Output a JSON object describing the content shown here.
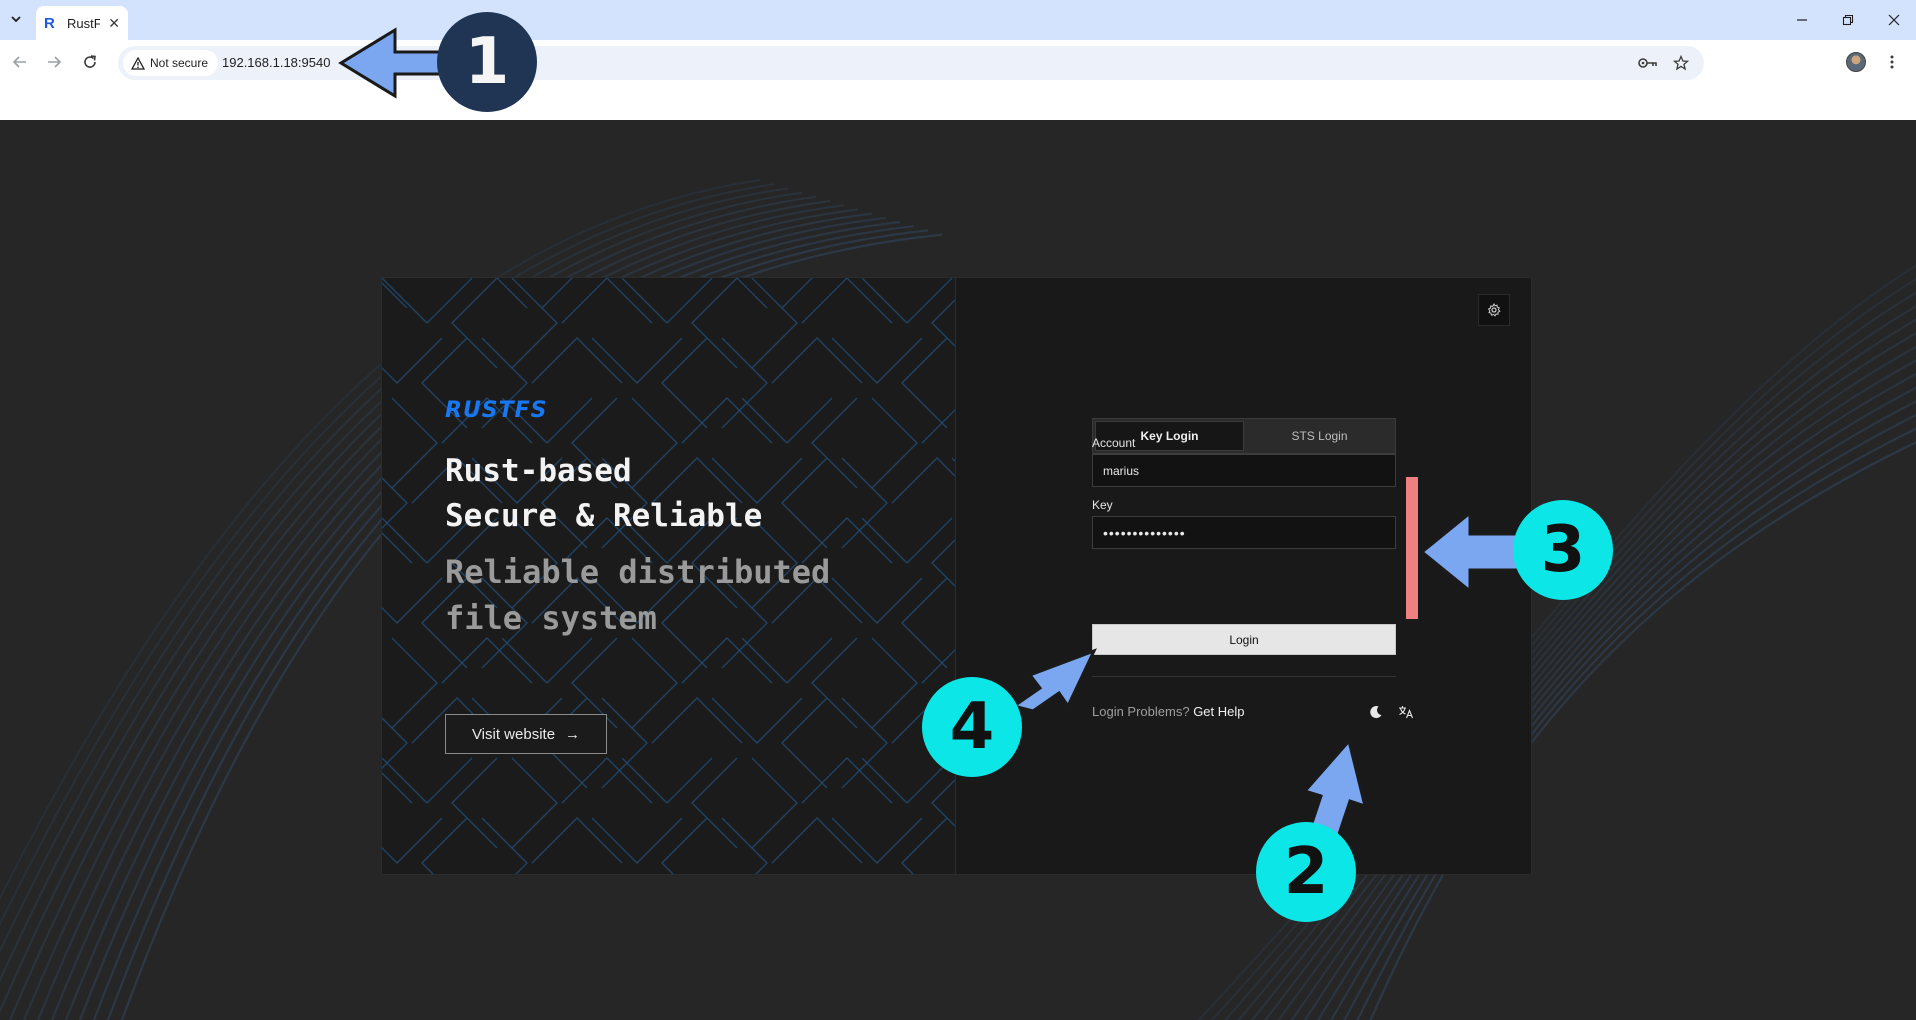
{
  "browser": {
    "tab_title": "RustFS",
    "tab_favicon": "R",
    "security_chip": "Not secure",
    "url": "192.168.1.18:9540"
  },
  "hero": {
    "brand": "RUSTFS",
    "headline_line1": "Rust-based",
    "headline_line2": "Secure & Reliable",
    "subline": "Reliable distributed file system",
    "visit_label": "Visit website",
    "visit_arrow": "→"
  },
  "login": {
    "tabs": [
      {
        "label": "Key Login",
        "active": true
      },
      {
        "label": "STS Login",
        "active": false
      }
    ],
    "account_label": "Account",
    "account_value": "marius",
    "key_label": "Key",
    "key_value": "••••••••••••••",
    "login_button": "Login",
    "help_text": "Login Problems?",
    "help_link": "Get Help"
  },
  "annotations": {
    "badge1": "1",
    "badge2": "2",
    "badge3": "3",
    "badge4": "4"
  },
  "colors": {
    "brand_blue": "#1877f2",
    "badge_cyan": "#0ce6e6",
    "badge_dark": "#1f3553",
    "arrow_blue": "#7aa7f0",
    "highlight_red": "#ee8080"
  },
  "icons": {
    "settings": "gear-icon",
    "theme": "moon-icon",
    "language": "translate-icon"
  }
}
